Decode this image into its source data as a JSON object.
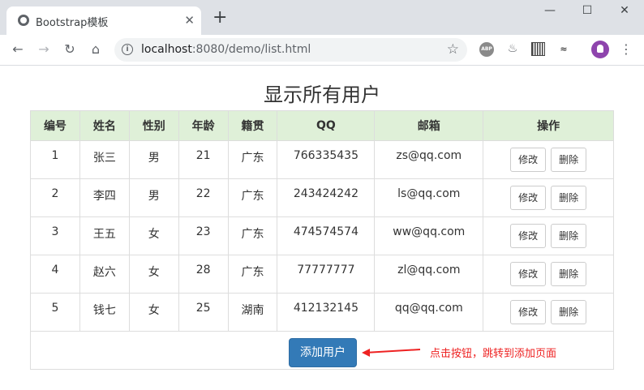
{
  "browser": {
    "tab_title": "Bootstrap模板",
    "tab_close": "✕",
    "new_tab": "+",
    "url_host": "localhost",
    "url_path": ":8080/demo/list.html",
    "back": "←",
    "forward": "→",
    "reload": "↻",
    "home": "⌂",
    "window_min": "—",
    "window_max": "☐",
    "window_close": "✕",
    "menu": "⋮",
    "star": "☆",
    "ext_abp": "ABP"
  },
  "page": {
    "title": "显示所有用户",
    "columns": [
      "编号",
      "姓名",
      "性别",
      "年龄",
      "籍贯",
      "QQ",
      "邮箱",
      "操作"
    ],
    "rows": [
      {
        "id": "1",
        "name": "张三",
        "gender": "男",
        "age": "21",
        "origin": "广东",
        "qq": "766335435",
        "email": "zs@qq.com"
      },
      {
        "id": "2",
        "name": "李四",
        "gender": "男",
        "age": "22",
        "origin": "广东",
        "qq": "243424242",
        "email": "ls@qq.com"
      },
      {
        "id": "3",
        "name": "王五",
        "gender": "女",
        "age": "23",
        "origin": "广东",
        "qq": "474574574",
        "email": "ww@qq.com"
      },
      {
        "id": "4",
        "name": "赵六",
        "gender": "女",
        "age": "28",
        "origin": "广东",
        "qq": "77777777",
        "email": "zl@qq.com"
      },
      {
        "id": "5",
        "name": "钱七",
        "gender": "女",
        "age": "25",
        "origin": "湖南",
        "qq": "412132145",
        "email": "qq@qq.com"
      }
    ],
    "edit_label": "修改",
    "delete_label": "删除",
    "add_button": "添加用户",
    "annotation": "点击按钮，跳转到添加页面"
  },
  "colors": {
    "header_bg": "#dff0d8",
    "primary": "#337ab7",
    "annotation": "#e22222"
  }
}
